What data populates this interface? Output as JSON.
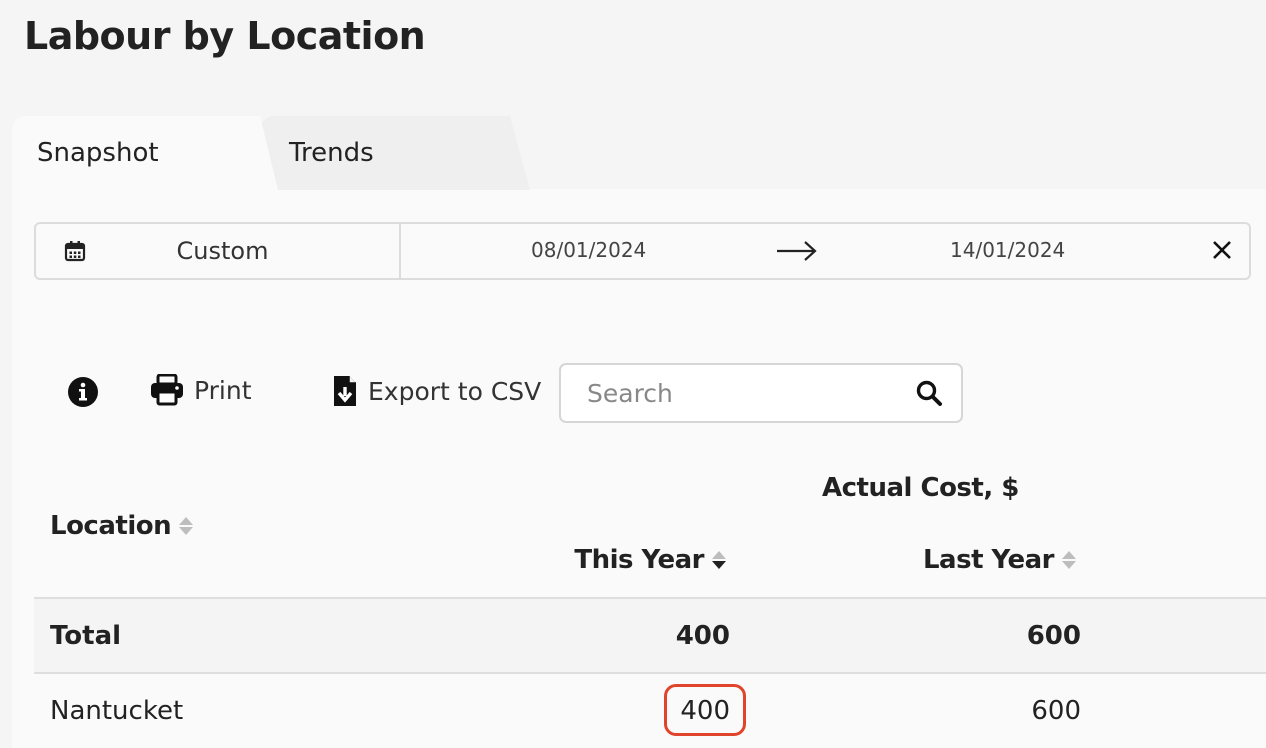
{
  "page": {
    "title": "Labour by Location"
  },
  "tabs": [
    {
      "label": "Snapshot",
      "active": true
    },
    {
      "label": "Trends",
      "active": false
    }
  ],
  "date_range": {
    "preset": "Custom",
    "start": "08/01/2024",
    "end": "14/01/2024"
  },
  "toolbar": {
    "print_label": "Print",
    "export_label": "Export to CSV",
    "search_placeholder": "Search"
  },
  "table": {
    "group_header": "Actual Cost, $",
    "columns": {
      "location": "Location",
      "this_year": "This Year",
      "last_year": "Last Year"
    },
    "sort": {
      "column": "this_year",
      "direction": "desc"
    },
    "total": {
      "label": "Total",
      "this_year": "400",
      "last_year": "600"
    },
    "rows": [
      {
        "location": "Nantucket",
        "this_year": "400",
        "last_year": "600"
      }
    ]
  },
  "colors": {
    "highlight": "#e0442a",
    "background": "#f5f5f5",
    "panel": "#fafafa"
  }
}
